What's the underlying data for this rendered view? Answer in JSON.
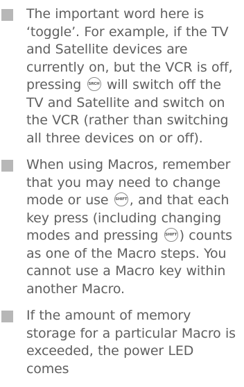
{
  "items": [
    {
      "p1": "The important word here is ‘toggle’. For example, if the TV and Satellite devices are currently on, but the VCR is off, pressing",
      "key": "SRCH",
      "p2": "will switch off the TV and Satellite and switch on the VCR (rather than switching all three devices on or off)."
    },
    {
      "p1": "When using Macros, remember that you may need to change mode or use",
      "key1": "SHIFT",
      "p2": ", and that each key press (including changing modes and pressing",
      "key2": "SHIFT",
      "p3": ") counts as one of the Macro steps. You cannot use a Macro key within another Macro."
    },
    {
      "p1": "If the amount of memory storage for a particular Macro is exceeded, the power LED comes"
    }
  ]
}
